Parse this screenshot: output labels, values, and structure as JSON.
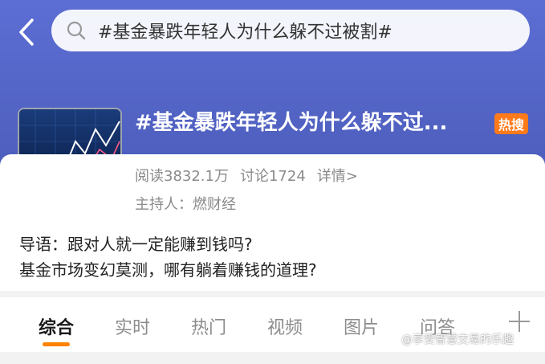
{
  "search": {
    "query": "#基金暴跌年轻人为什么躲不过被割#"
  },
  "topic": {
    "title": "#基金暴跌年轻人为什么躲不过...",
    "badge": "热搜",
    "reads": "阅读3832.1万",
    "discussions": "讨论1724",
    "detail_link": "详情>",
    "host": "主持人：燃财经",
    "intro_line1": "导语：跟对人就一定能赚到钱吗?",
    "intro_line2": "基金市场变幻莫测，哪有躺着赚钱的道理?"
  },
  "tabs": [
    {
      "label": "综合",
      "active": true
    },
    {
      "label": "实时",
      "active": false
    },
    {
      "label": "热门",
      "active": false
    },
    {
      "label": "视频",
      "active": false
    },
    {
      "label": "图片",
      "active": false
    },
    {
      "label": "问答",
      "active": false
    }
  ],
  "watermark": "@享受智慧交易的乐趣",
  "icons": {
    "back": "back-arrow-icon",
    "search": "search-icon",
    "add_tab": "plus-icon"
  },
  "colors": {
    "header": "#5567c9",
    "accent": "#ff8200",
    "badge": "#ff7a1a"
  }
}
